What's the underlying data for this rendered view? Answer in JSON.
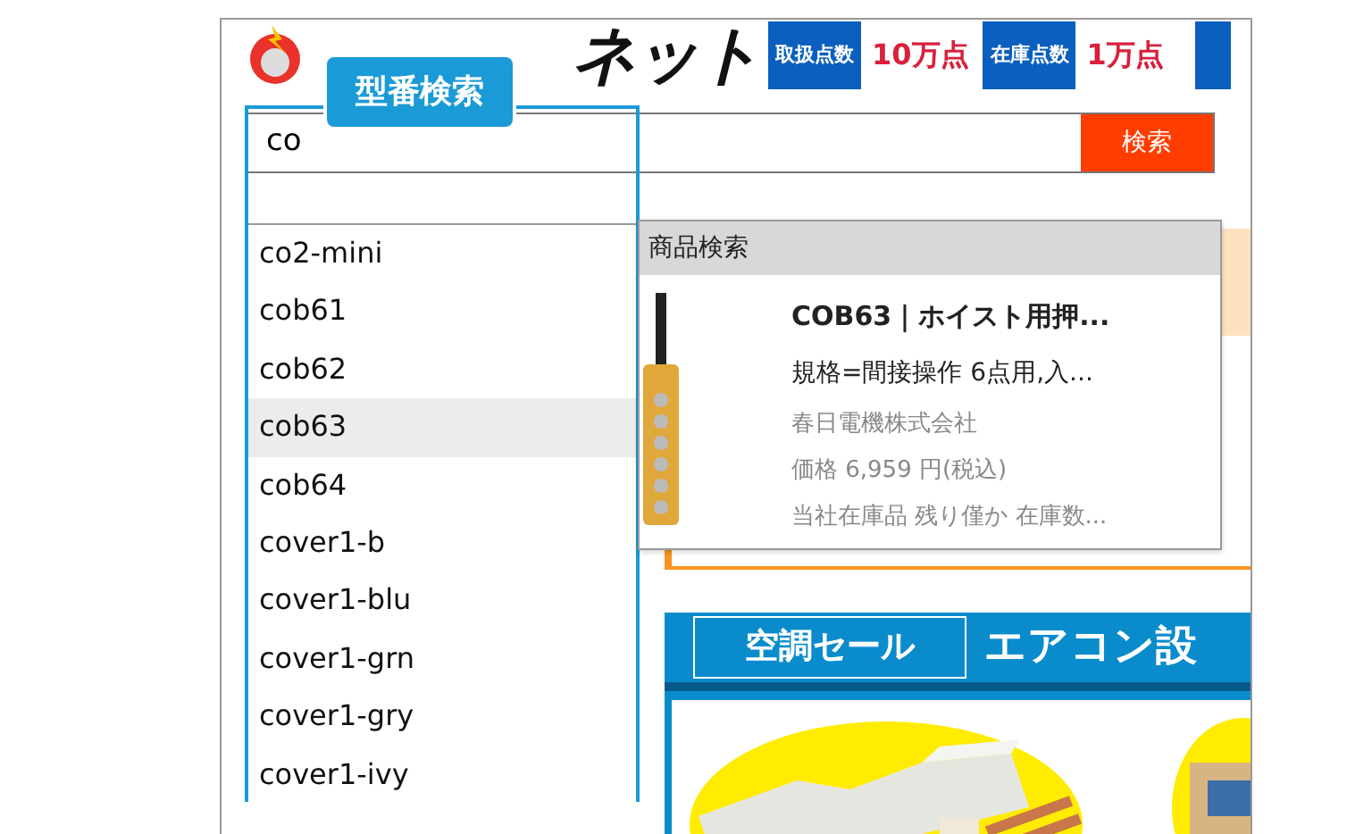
{
  "header": {
    "logo_text": "ネット",
    "stats": [
      {
        "label": "取扱点数",
        "value": "10万点"
      },
      {
        "label": "在庫点数",
        "value": "1万点"
      }
    ]
  },
  "search": {
    "label": "型番検索",
    "value": "co",
    "button": "検索"
  },
  "suggestions": [
    {
      "text": "co2-mini",
      "selected": false
    },
    {
      "text": "cob61",
      "selected": false
    },
    {
      "text": "cob62",
      "selected": false
    },
    {
      "text": "cob63",
      "selected": true
    },
    {
      "text": "cob64",
      "selected": false
    },
    {
      "text": "cover1-b",
      "selected": false
    },
    {
      "text": "cover1-blu",
      "selected": false
    },
    {
      "text": "cover1-grn",
      "selected": false
    },
    {
      "text": "cover1-gry",
      "selected": false
    },
    {
      "text": "cover1-ivy",
      "selected": false
    }
  ],
  "product_popup": {
    "title": "商品検索",
    "name": "COB63｜ホイスト用押...",
    "spec": "規格=間接操作 6点用,入...",
    "maker": "春日電機株式会社",
    "price": "価格 6,959 円(税込)",
    "stock": "当社在庫品 残り僅か 在庫数..."
  },
  "banner": {
    "tag": "空調セール",
    "title": "エアコン設"
  }
}
